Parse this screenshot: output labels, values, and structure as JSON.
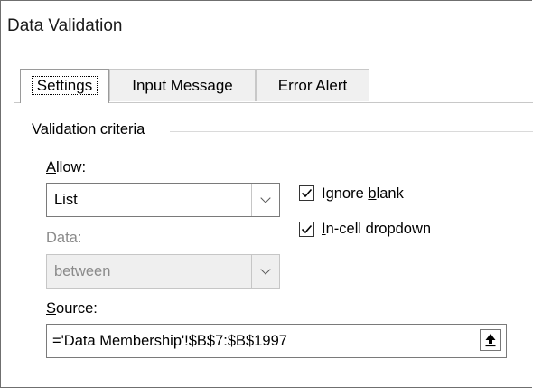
{
  "dialog": {
    "title": "Data Validation"
  },
  "tabs": [
    {
      "label": "Settings",
      "active": true
    },
    {
      "label": "Input Message",
      "active": false
    },
    {
      "label": "Error Alert",
      "active": false
    }
  ],
  "criteria": {
    "group_label": "Validation criteria",
    "allow": {
      "label_ul": "A",
      "label_rest": "llow:",
      "value": "List"
    },
    "data": {
      "label": "Data:",
      "value": "between",
      "enabled": false
    },
    "ignore_blank": {
      "label_pre": "Ignore ",
      "label_ul": "b",
      "label_post": "lank",
      "checked": true
    },
    "in_cell_dropdown": {
      "label_ul": "I",
      "label_post": "n-cell dropdown",
      "checked": true
    },
    "source": {
      "label_ul": "S",
      "label_rest": "ource:",
      "value": "='Data Membership'!$B$7:$B$1997"
    }
  },
  "icons": {
    "dropdown": "chevron-down-icon",
    "check": "checkmark-icon",
    "collapse": "collapse-dialog-icon"
  }
}
